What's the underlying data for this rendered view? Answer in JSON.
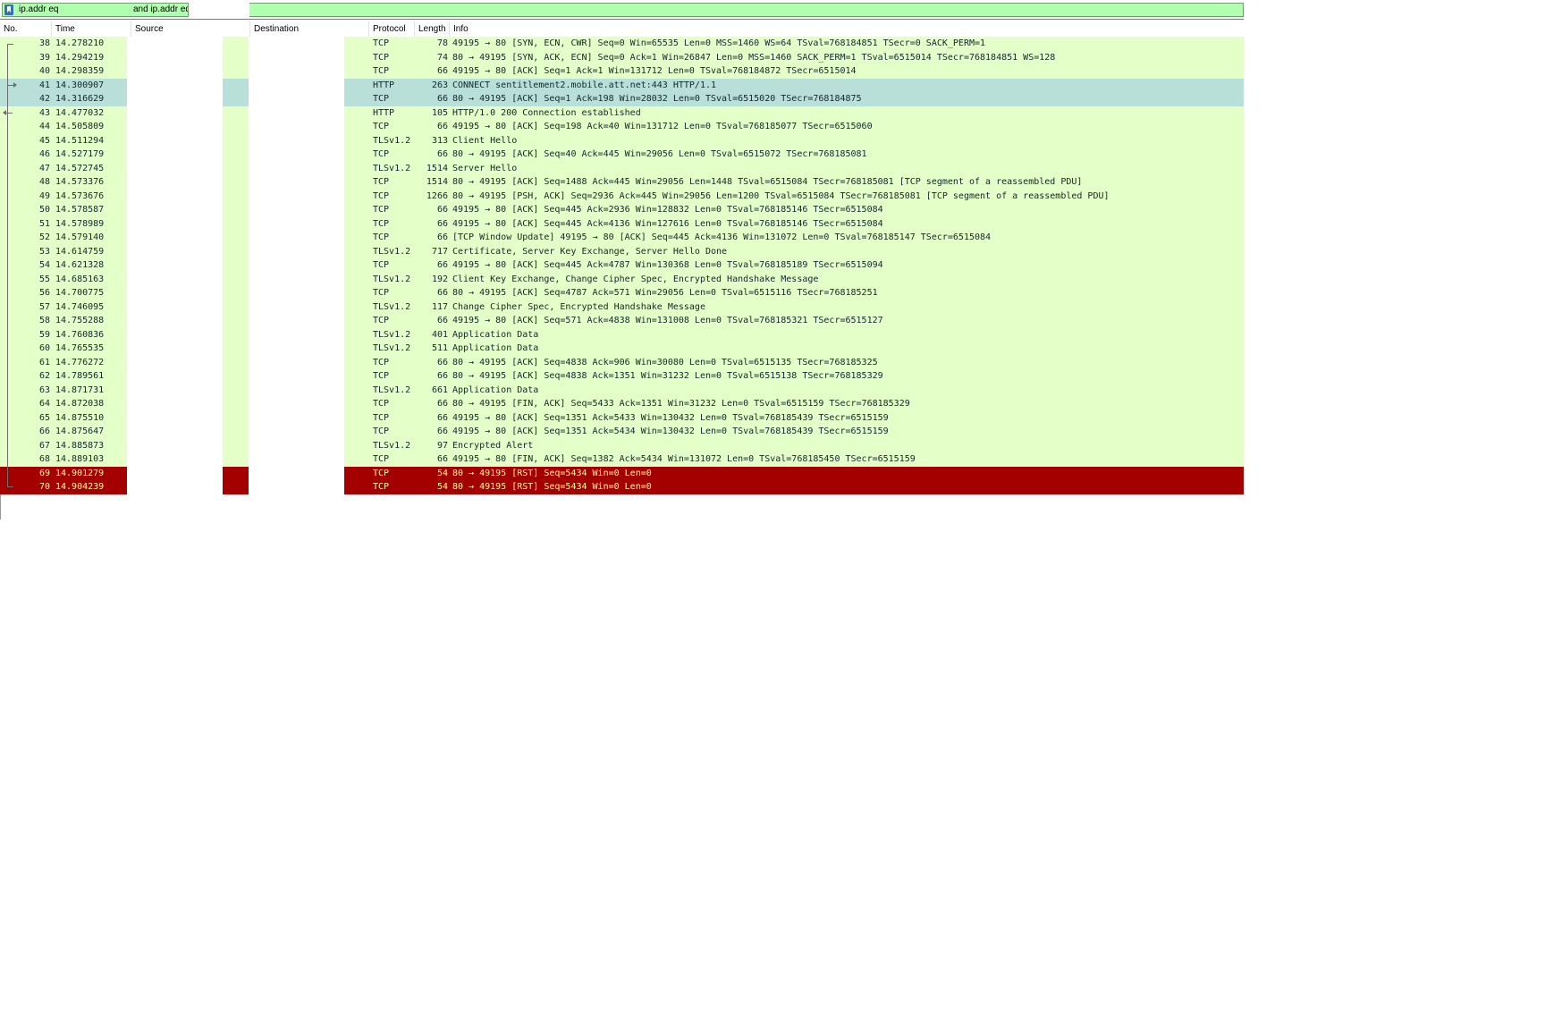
{
  "filter": {
    "segment1": "ip.addr eq",
    "segment2": "and ip.addr eq"
  },
  "columns": [
    "No.",
    "Time",
    "Source",
    "Destination",
    "Protocol",
    "Length",
    "Info"
  ],
  "colors": {
    "tcp_row": "#e4ffc7",
    "selected_row": "#b8dfd8",
    "rst_row": "#a40000",
    "rst_text": "#fffc9c",
    "filter_valid": "#afffaf"
  },
  "packets": [
    {
      "no": "38",
      "time": "14.278210",
      "proto": "TCP",
      "len": "78",
      "info": "49195 → 80 [SYN, ECN, CWR] Seq=0 Win=65535 Len=0 MSS=1460 WS=64 TSval=768184851 TSecr=0 SACK_PERM=1",
      "style": "green"
    },
    {
      "no": "39",
      "time": "14.294219",
      "proto": "TCP",
      "len": "74",
      "info": "80 → 49195 [SYN, ACK, ECN] Seq=0 Ack=1 Win=26847 Len=0 MSS=1460 SACK_PERM=1 TSval=6515014 TSecr=768184851 WS=128",
      "style": "green"
    },
    {
      "no": "40",
      "time": "14.298359",
      "proto": "TCP",
      "len": "66",
      "info": "49195 → 80 [ACK] Seq=1 Ack=1 Win=131712 Len=0 TSval=768184872 TSecr=6515014",
      "style": "green"
    },
    {
      "no": "41",
      "time": "14.300907",
      "proto": "HTTP",
      "len": "263",
      "info": "CONNECT sentitlement2.mobile.att.net:443 HTTP/1.1",
      "style": "teal"
    },
    {
      "no": "42",
      "time": "14.316629",
      "proto": "TCP",
      "len": "66",
      "info": "80 → 49195 [ACK] Seq=1 Ack=198 Win=28032 Len=0 TSval=6515020 TSecr=768184875",
      "style": "teal"
    },
    {
      "no": "43",
      "time": "14.477032",
      "proto": "HTTP",
      "len": "105",
      "info": "HTTP/1.0 200 Connection established",
      "style": "green"
    },
    {
      "no": "44",
      "time": "14.505809",
      "proto": "TCP",
      "len": "66",
      "info": "49195 → 80 [ACK] Seq=198 Ack=40 Win=131712 Len=0 TSval=768185077 TSecr=6515060",
      "style": "green"
    },
    {
      "no": "45",
      "time": "14.511294",
      "proto": "TLSv1.2",
      "len": "313",
      "info": "Client Hello",
      "style": "green"
    },
    {
      "no": "46",
      "time": "14.527179",
      "proto": "TCP",
      "len": "66",
      "info": "80 → 49195 [ACK] Seq=40 Ack=445 Win=29056 Len=0 TSval=6515072 TSecr=768185081",
      "style": "green"
    },
    {
      "no": "47",
      "time": "14.572745",
      "proto": "TLSv1.2",
      "len": "1514",
      "info": "Server Hello",
      "style": "green"
    },
    {
      "no": "48",
      "time": "14.573376",
      "proto": "TCP",
      "len": "1514",
      "info": "80 → 49195 [ACK] Seq=1488 Ack=445 Win=29056 Len=1448 TSval=6515084 TSecr=768185081 [TCP segment of a reassembled PDU]",
      "style": "green"
    },
    {
      "no": "49",
      "time": "14.573676",
      "proto": "TCP",
      "len": "1266",
      "info": "80 → 49195 [PSH, ACK] Seq=2936 Ack=445 Win=29056 Len=1200 TSval=6515084 TSecr=768185081 [TCP segment of a reassembled PDU]",
      "style": "green"
    },
    {
      "no": "50",
      "time": "14.578587",
      "proto": "TCP",
      "len": "66",
      "info": "49195 → 80 [ACK] Seq=445 Ack=2936 Win=128832 Len=0 TSval=768185146 TSecr=6515084",
      "style": "green"
    },
    {
      "no": "51",
      "time": "14.578989",
      "proto": "TCP",
      "len": "66",
      "info": "49195 → 80 [ACK] Seq=445 Ack=4136 Win=127616 Len=0 TSval=768185146 TSecr=6515084",
      "style": "green"
    },
    {
      "no": "52",
      "time": "14.579140",
      "proto": "TCP",
      "len": "66",
      "info": "[TCP Window Update] 49195 → 80 [ACK] Seq=445 Ack=4136 Win=131072 Len=0 TSval=768185147 TSecr=6515084",
      "style": "green"
    },
    {
      "no": "53",
      "time": "14.614759",
      "proto": "TLSv1.2",
      "len": "717",
      "info": "Certificate, Server Key Exchange, Server Hello Done",
      "style": "green"
    },
    {
      "no": "54",
      "time": "14.621328",
      "proto": "TCP",
      "len": "66",
      "info": "49195 → 80 [ACK] Seq=445 Ack=4787 Win=130368 Len=0 TSval=768185189 TSecr=6515094",
      "style": "green"
    },
    {
      "no": "55",
      "time": "14.685163",
      "proto": "TLSv1.2",
      "len": "192",
      "info": "Client Key Exchange, Change Cipher Spec, Encrypted Handshake Message",
      "style": "green"
    },
    {
      "no": "56",
      "time": "14.700775",
      "proto": "TCP",
      "len": "66",
      "info": "80 → 49195 [ACK] Seq=4787 Ack=571 Win=29056 Len=0 TSval=6515116 TSecr=768185251",
      "style": "green"
    },
    {
      "no": "57",
      "time": "14.746095",
      "proto": "TLSv1.2",
      "len": "117",
      "info": "Change Cipher Spec, Encrypted Handshake Message",
      "style": "green"
    },
    {
      "no": "58",
      "time": "14.755288",
      "proto": "TCP",
      "len": "66",
      "info": "49195 → 80 [ACK] Seq=571 Ack=4838 Win=131008 Len=0 TSval=768185321 TSecr=6515127",
      "style": "green"
    },
    {
      "no": "59",
      "time": "14.760836",
      "proto": "TLSv1.2",
      "len": "401",
      "info": "Application Data",
      "style": "green"
    },
    {
      "no": "60",
      "time": "14.765535",
      "proto": "TLSv1.2",
      "len": "511",
      "info": "Application Data",
      "style": "green"
    },
    {
      "no": "61",
      "time": "14.776272",
      "proto": "TCP",
      "len": "66",
      "info": "80 → 49195 [ACK] Seq=4838 Ack=906 Win=30080 Len=0 TSval=6515135 TSecr=768185325",
      "style": "green"
    },
    {
      "no": "62",
      "time": "14.789561",
      "proto": "TCP",
      "len": "66",
      "info": "80 → 49195 [ACK] Seq=4838 Ack=1351 Win=31232 Len=0 TSval=6515138 TSecr=768185329",
      "style": "green"
    },
    {
      "no": "63",
      "time": "14.871731",
      "proto": "TLSv1.2",
      "len": "661",
      "info": "Application Data",
      "style": "green"
    },
    {
      "no": "64",
      "time": "14.872038",
      "proto": "TCP",
      "len": "66",
      "info": "80 → 49195 [FIN, ACK] Seq=5433 Ack=1351 Win=31232 Len=0 TSval=6515159 TSecr=768185329",
      "style": "green"
    },
    {
      "no": "65",
      "time": "14.875510",
      "proto": "TCP",
      "len": "66",
      "info": "49195 → 80 [ACK] Seq=1351 Ack=5433 Win=130432 Len=0 TSval=768185439 TSecr=6515159",
      "style": "green"
    },
    {
      "no": "66",
      "time": "14.875647",
      "proto": "TCP",
      "len": "66",
      "info": "49195 → 80 [ACK] Seq=1351 Ack=5434 Win=130432 Len=0 TSval=768185439 TSecr=6515159",
      "style": "green"
    },
    {
      "no": "67",
      "time": "14.885873",
      "proto": "TLSv1.2",
      "len": "97",
      "info": "Encrypted Alert",
      "style": "green"
    },
    {
      "no": "68",
      "time": "14.889103",
      "proto": "TCP",
      "len": "66",
      "info": "49195 → 80 [FIN, ACK] Seq=1382 Ack=5434 Win=131072 Len=0 TSval=768185450 TSecr=6515159",
      "style": "green"
    },
    {
      "no": "69",
      "time": "14.901279",
      "proto": "TCP",
      "len": "54",
      "info": "80 → 49195 [RST] Seq=5434 Win=0 Len=0",
      "style": "red"
    },
    {
      "no": "70",
      "time": "14.904239",
      "proto": "TCP",
      "len": "54",
      "info": "80 → 49195 [RST] Seq=5434 Win=0 Len=0",
      "style": "red"
    }
  ]
}
